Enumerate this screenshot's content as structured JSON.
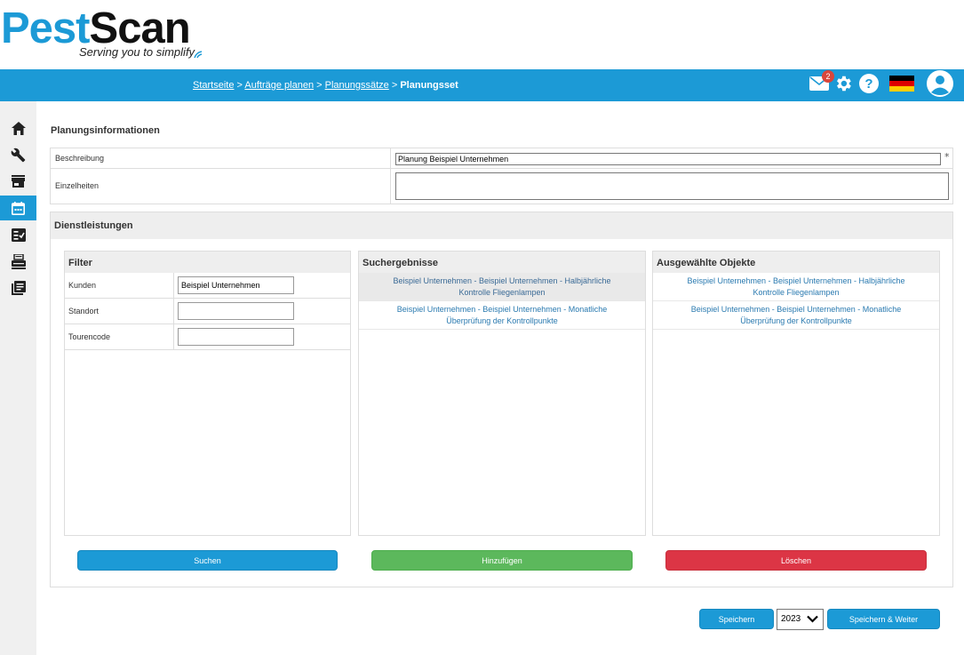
{
  "logo": {
    "part1": "Pest",
    "part2": "Scan",
    "tagline": "Serving you to simplify"
  },
  "colors": {
    "brand": "#1c9ad6",
    "green": "#5cb85c",
    "red": "#dc3545",
    "badge": "#d9463b"
  },
  "breadcrumb": {
    "items": [
      "Startseite",
      "Aufträge planen",
      "Planungssätze"
    ],
    "separator": " > ",
    "current": "Planungsset"
  },
  "topbar": {
    "mail_count": "2",
    "icons": [
      "mail-icon",
      "gear-icon",
      "help-icon",
      "german-flag-icon",
      "user-avatar-icon"
    ]
  },
  "sidebar": {
    "items": [
      "home-icon",
      "wrench-icon",
      "store-icon",
      "calendar-icon",
      "checklist-icon",
      "printer-icon",
      "documents-icon"
    ],
    "active": "calendar-icon"
  },
  "planning": {
    "title": "Planungsinformationen",
    "description_label": "Beschreibung",
    "description_value": "Planung Beispiel Unternehmen",
    "required_mark": "*",
    "details_label": "Einzelheiten",
    "details_value": ""
  },
  "services": {
    "title": "Dienstleistungen",
    "filter": {
      "title": "Filter",
      "rows": [
        {
          "label": "Kunden",
          "value": "Beispiel Unternehmen"
        },
        {
          "label": "Standort",
          "value": ""
        },
        {
          "label": "Tourencode",
          "value": ""
        }
      ]
    },
    "results": {
      "title": "Suchergebnisse",
      "items": [
        {
          "line1": "Beispiel Unternehmen - Beispiel Unternehmen - Halbjährliche",
          "line2": "Kontrolle Fliegenlampen",
          "selected": true
        },
        {
          "line1": "Beispiel Unternehmen - Beispiel Unternehmen - Monatliche",
          "line2": "Überprüfung der Kontrollpunkte",
          "selected": false
        }
      ]
    },
    "selected": {
      "title": "Ausgewählte Objekte",
      "items": [
        {
          "line1": "Beispiel Unternehmen - Beispiel Unternehmen - Halbjährliche",
          "line2": "Kontrolle Fliegenlampen"
        },
        {
          "line1": "Beispiel Unternehmen - Beispiel Unternehmen - Monatliche",
          "line2": "Überprüfung der Kontrollpunkte"
        }
      ]
    },
    "buttons": {
      "search": "Suchen",
      "add": "Hinzufügen",
      "delete": "Löschen"
    }
  },
  "footer": {
    "save": "Speichern",
    "year": "2023",
    "save_continue": "Speichern & Weiter"
  }
}
